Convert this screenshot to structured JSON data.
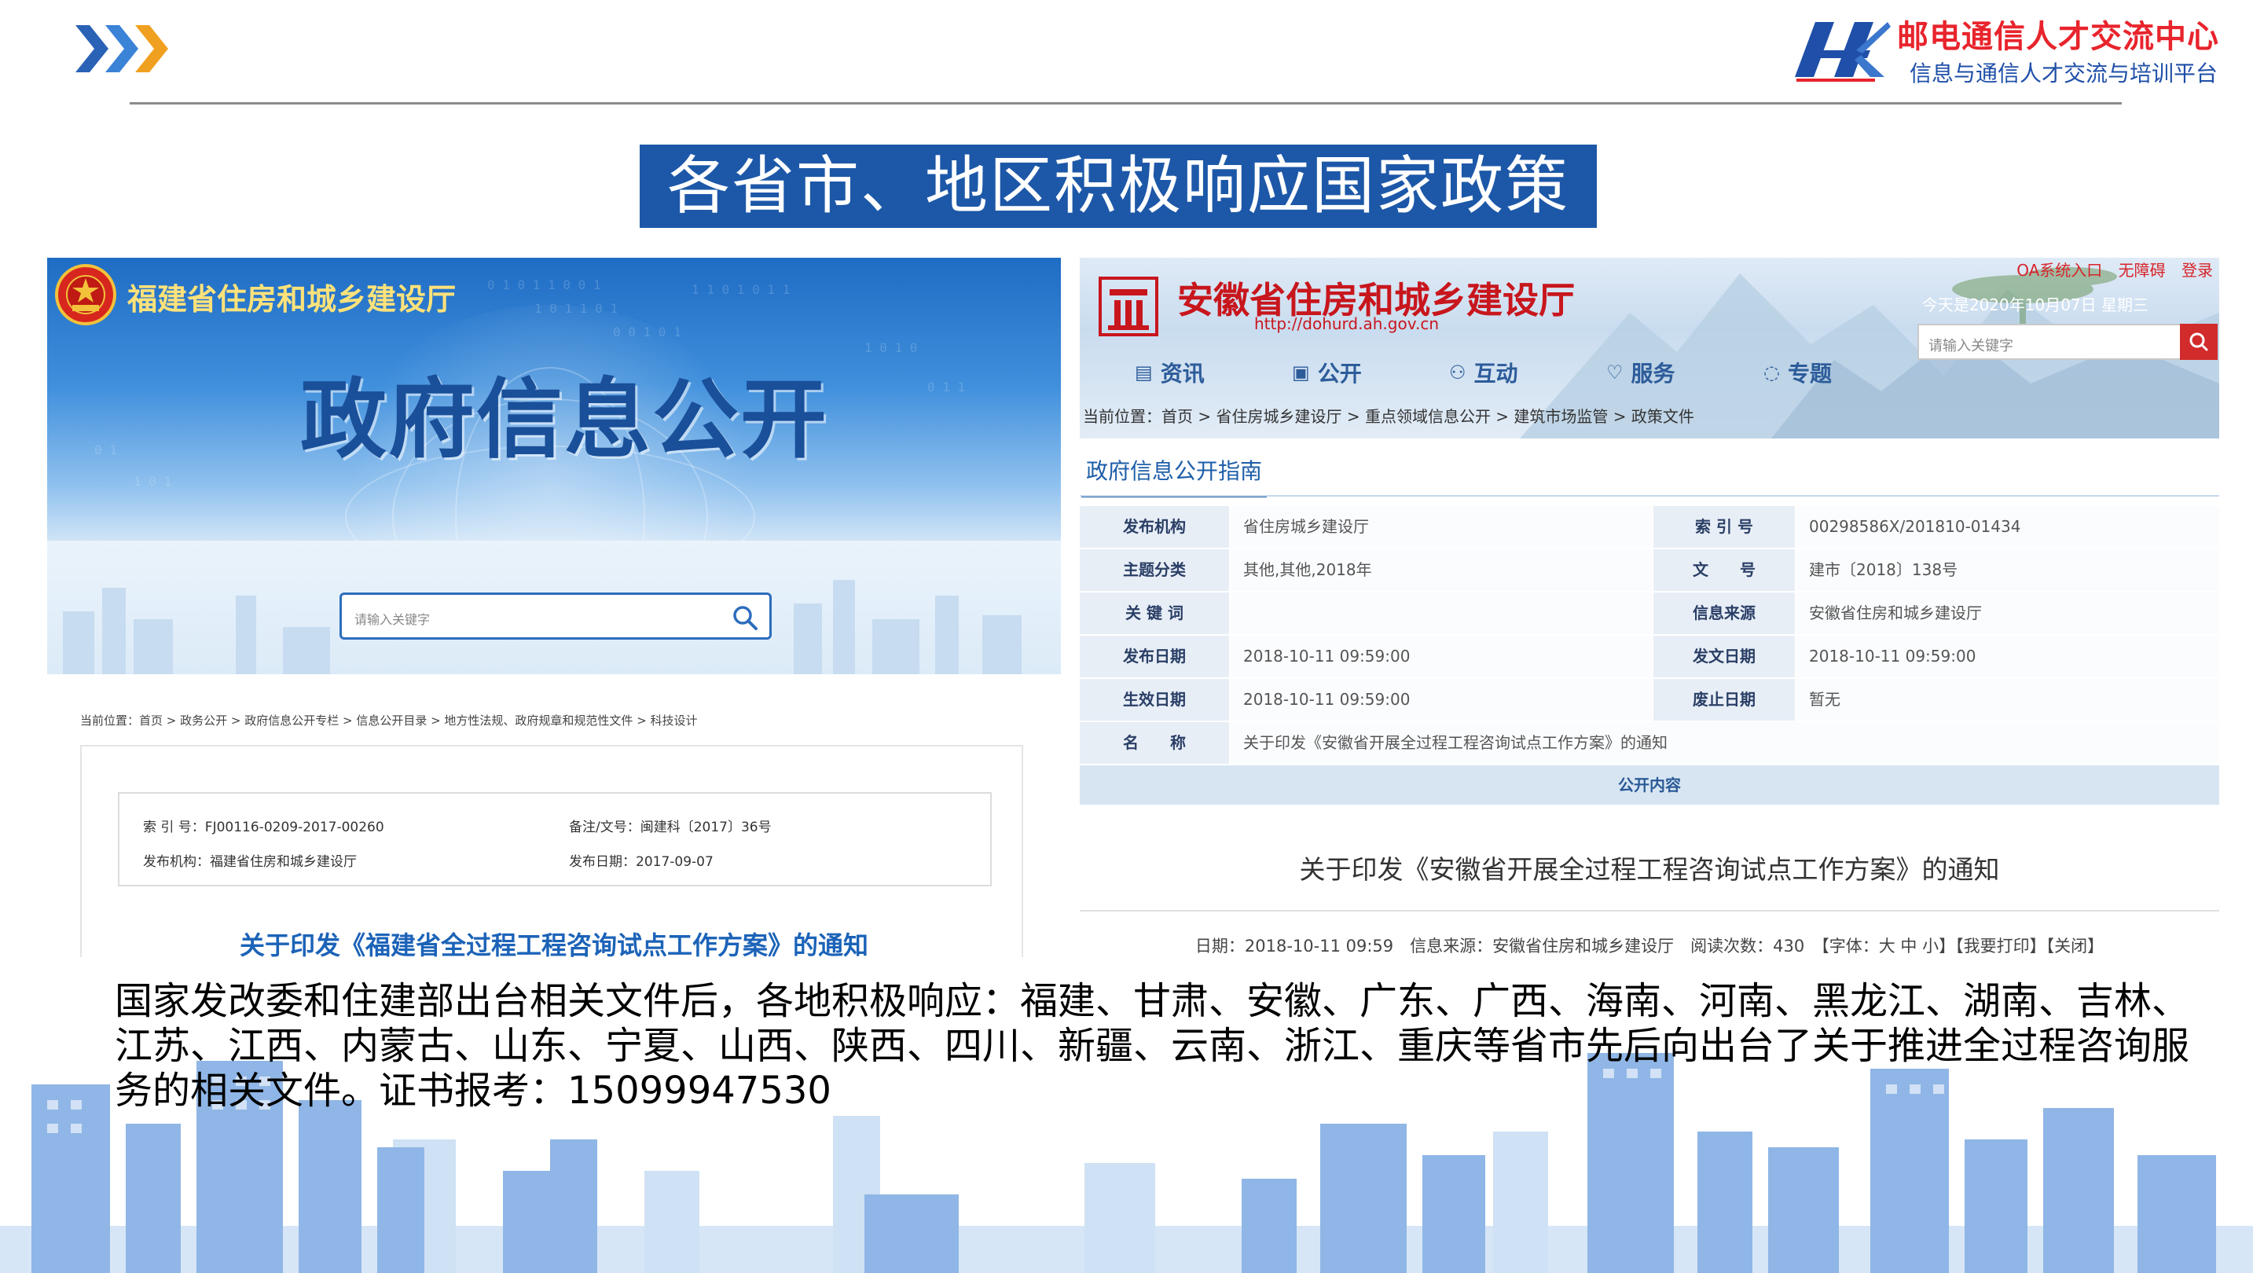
{
  "header": {
    "org_name": "邮电通信人才交流中心",
    "org_tagline": "信息与通信人才交流与培训平台"
  },
  "slide_title": "各省市、地区积极响应国家政策",
  "fujian": {
    "site_name": "福建省住房和城乡建设厅",
    "banner_title": "政府信息公开",
    "search_placeholder": "请输入关键字",
    "breadcrumb": "当前位置：首页 > 政务公开 > 政府信息公开专栏 > 信息公开目录 > 地方性法规、政府规章和规范性文件 > 科技设计",
    "index_no": "索 引 号：FJ00116-0209-2017-00260",
    "doc_no": "备注/文号：闽建科〔2017〕36号",
    "issuer": "发布机构：福建省住房和城乡建设厅",
    "publish_date": "发布日期：2017-09-07",
    "notice_title": "关于印发《福建省全过程工程咨询试点工作方案》的通知"
  },
  "anhui": {
    "site_name": "安徽省住房和城乡建设厅",
    "url": "http://dohurd.ah.gov.cn",
    "top_links": [
      "OA系统入口",
      "无障碍",
      "登录"
    ],
    "date_text": "今天是2020年10月07日 星期三",
    "search_placeholder": "请输入关键字",
    "nav": [
      {
        "label": "资讯",
        "icon": "news-icon"
      },
      {
        "label": "公开",
        "icon": "open-icon"
      },
      {
        "label": "互动",
        "icon": "interact-icon"
      },
      {
        "label": "服务",
        "icon": "service-icon"
      },
      {
        "label": "专题",
        "icon": "topic-icon"
      }
    ],
    "breadcrumb": "当前位置：首页 > 省住房城乡建设厅 > 重点领域信息公开 > 建筑市场监管 > 政策文件",
    "guide_title": "政府信息公开指南",
    "table": {
      "r0": {
        "l1": "发布机构",
        "v1": "省住房城乡建设厅",
        "l2": "索 引 号",
        "v2": "00298586X/201810-01434"
      },
      "r1": {
        "l1": "主题分类",
        "v1": "其他,其他,2018年",
        "l2": "文　　号",
        "v2": "建市〔2018〕138号"
      },
      "r2": {
        "l1": "关 键 词",
        "v1": "",
        "l2": "信息来源",
        "v2": "安徽省住房和城乡建设厅"
      },
      "r3": {
        "l1": "发布日期",
        "v1": "2018-10-11 09:59:00",
        "l2": "发文日期",
        "v2": "2018-10-11 09:59:00"
      },
      "r4": {
        "l1": "生效日期",
        "v1": "2018-10-11 09:59:00",
        "l2": "废止日期",
        "v2": "暂无"
      },
      "r5": {
        "l1": "名　　称",
        "v1": "关于印发《安徽省开展全过程工程咨询试点工作方案》的通知"
      }
    },
    "public_content_label": "公开内容",
    "doc_title": "关于印发《安徽省开展全过程工程咨询试点工作方案》的通知",
    "footer": "日期：2018-10-11 09:59　信息来源：安徽省住房和城乡建设厅　阅读次数：430　【字体：大 中 小】【我要打印】【关闭】"
  },
  "body_text": "国家发改委和住建部出台相关文件后，各地积极响应：福建、甘肃、安徽、广东、广西、海南、河南、黑龙江、湖南、吉林、江苏、江西、内蒙古、山东、宁夏、山西、陕西、四川、新疆、云南、浙江、重庆等省市先后向出台了关于推进全过程咨询服务的相关文件。证书报考：15099947530",
  "colors": {
    "title_bg": "#1d58a8",
    "brand_red": "#e8242c",
    "brand_blue": "#1f4fa8",
    "chevron_blue": "#2a62b5",
    "chevron_orange": "#f0a020"
  }
}
